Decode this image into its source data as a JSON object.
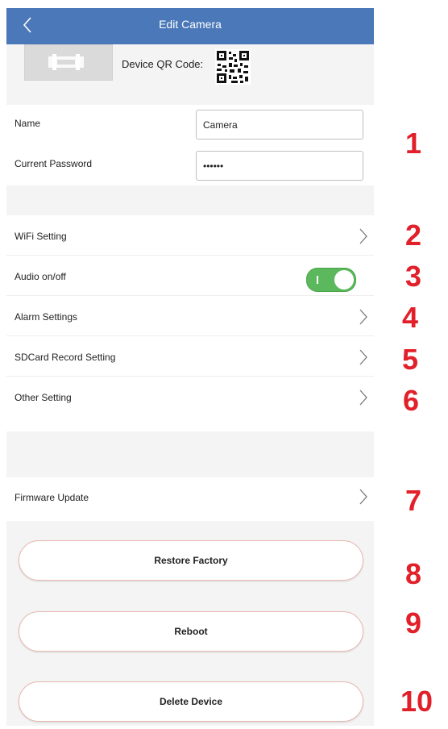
{
  "header": {
    "title": "Edit Camera"
  },
  "device": {
    "qr_label": "Device QR Code:"
  },
  "form": {
    "name_label": "Name",
    "name_value": "Camera",
    "password_label": "Current Password",
    "password_value": "••••••"
  },
  "menu": {
    "wifi": "WiFi Setting",
    "audio": "Audio on/off",
    "audio_on": true,
    "alarm": "Alarm Settings",
    "sdcard": "SDCard Record Setting",
    "other": "Other Setting",
    "firmware": "Firmware Update"
  },
  "actions": {
    "restore": "Restore Factory",
    "reboot": "Reboot",
    "delete": "Delete Device"
  },
  "annotations": [
    "1",
    "2",
    "3",
    "4",
    "5",
    "6",
    "7",
    "8",
    "9",
    "10"
  ],
  "colors": {
    "header": "#4a78b8",
    "toggle_on": "#5cb85c",
    "annotation": "#e2202a"
  }
}
